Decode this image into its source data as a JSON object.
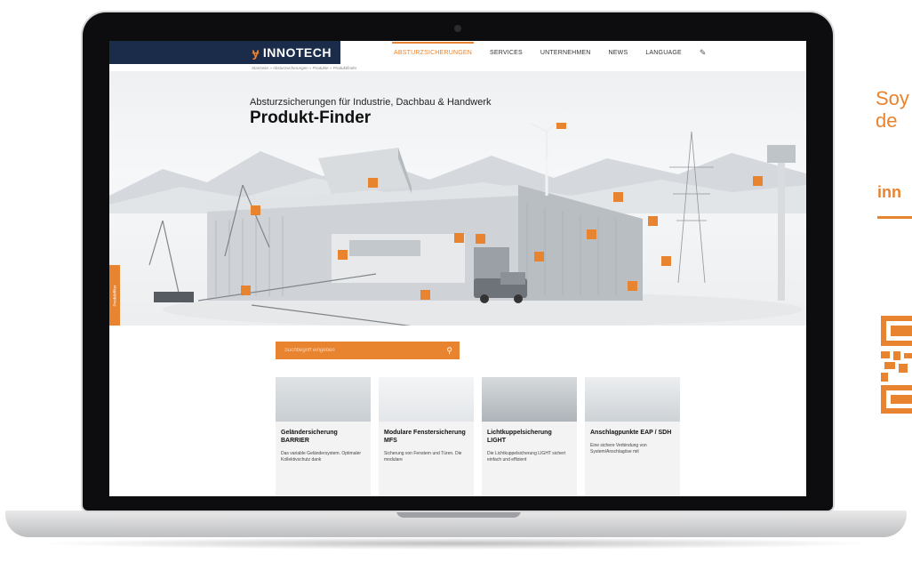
{
  "header": {
    "logo": "INNOTECH",
    "nav": [
      "ABSTURZSICHERUNGEN",
      "SERVICES",
      "UNTERNEHMEN",
      "NEWS",
      "LANGUAGE"
    ],
    "active_nav": "ABSTURZSICHERUNGEN"
  },
  "breadcrumb": "Startseite » Absturzsicherungen » Produkte » Produktfinder",
  "hero": {
    "subtitle": "Absturzsicherungen für Industrie, Dachbau & Handwerk",
    "title": "Produkt-Finder"
  },
  "side_tab": "Produktfilter",
  "search": {
    "placeholder": "Suchbegriff eingeben"
  },
  "cards": [
    {
      "title": "Geländersicherung BARRIER",
      "desc": "Das variable Geländersystem. Optimaler Kollektivschutz dank"
    },
    {
      "title": "Modulare Fenstersicherung MFS",
      "desc": "Sicherung von Fenstern und Türen. Die modulare"
    },
    {
      "title": "Lichtkuppelsicherung LIGHT",
      "desc": "Die Lichtkuppelsicherung LIGHT sichert einfach und effizient"
    },
    {
      "title": "Anschlagpunkte EAP / SDH",
      "desc": "Eine sichere Verbindung von System/Anschlagöse mit"
    }
  ],
  "ad": {
    "line1": "Soy",
    "line2": "de",
    "brand": "inn"
  },
  "colors": {
    "accent": "#e8832f",
    "navy": "#1b2b4a"
  }
}
